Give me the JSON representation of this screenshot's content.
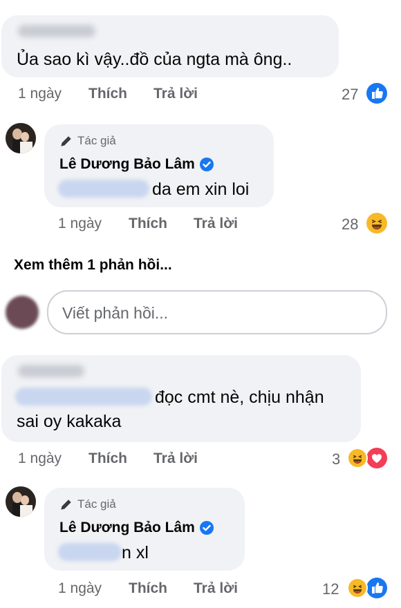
{
  "comment1": {
    "text": "Ủa sao kì vậy..đồ của ngta mà ông..",
    "time": "1 ngày",
    "like": "Thích",
    "reply": "Trả lời",
    "reaction_count": "27",
    "reactions": [
      "like-reaction-icon"
    ]
  },
  "reply1": {
    "author_tag": "Tác giả",
    "author_name": "Lê Dương Bảo Lâm",
    "text": "da em xin loi",
    "time": "1 ngày",
    "like": "Thích",
    "reply": "Trả lời",
    "reaction_count": "28",
    "reactions": [
      "haha-reaction-icon"
    ]
  },
  "see_more": "Xem thêm 1 phản hồi...",
  "reply_box": {
    "placeholder": "Viết phản hồi..."
  },
  "comment2": {
    "text_line1": "đọc cmt nè, chịu nhận",
    "text_line2": "sai oy kakaka",
    "time": "1 ngày",
    "like": "Thích",
    "reply": "Trả lời",
    "reaction_count": "3",
    "reactions": [
      "haha-reaction-icon",
      "love-reaction-icon"
    ]
  },
  "reply2": {
    "author_tag": "Tác giả",
    "author_name": "Lê Dương Bảo Lâm",
    "text": "n xl",
    "time": "1 ngày",
    "like": "Thích",
    "reply": "Trả lời",
    "reaction_count": "12",
    "reactions": [
      "haha-reaction-icon",
      "like-reaction-icon"
    ]
  },
  "colors": {
    "bubble": "#f0f2f5",
    "meta_text": "#65676b",
    "like_blue": "#1877f2",
    "haha_yellow": "#f7b928",
    "love_red": "#f33e58",
    "verified_blue": "#1877f2"
  }
}
